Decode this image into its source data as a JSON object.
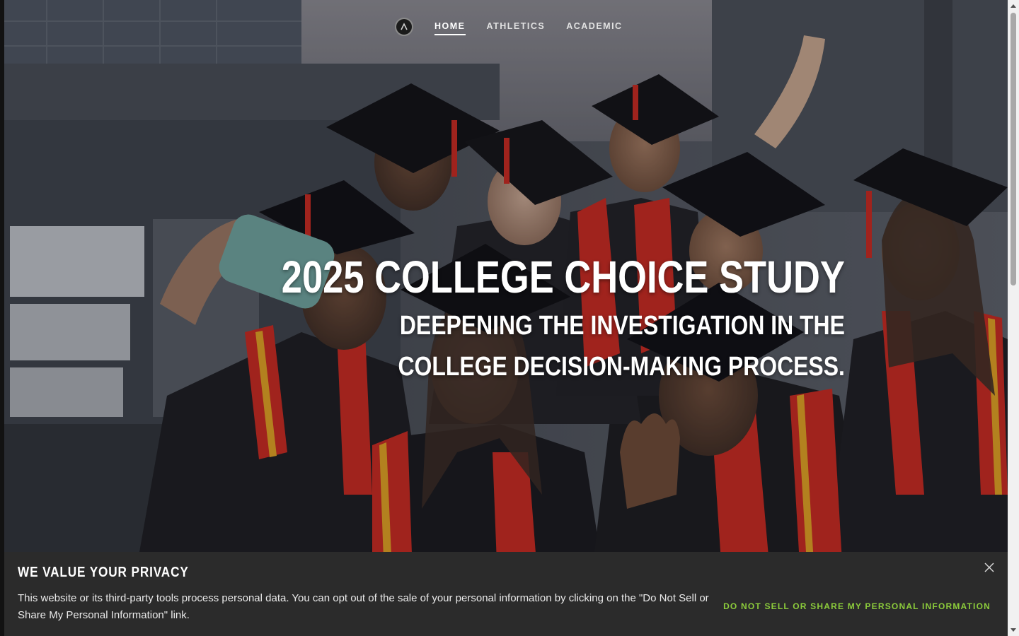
{
  "nav": {
    "logo_icon": "logo-circle-icon",
    "items": [
      {
        "label": "HOME",
        "active": true
      },
      {
        "label": "ATHLETICS",
        "active": false
      },
      {
        "label": "ACADEMIC",
        "active": false
      }
    ]
  },
  "hero": {
    "title": "2025 COLLEGE CHOICE STUDY",
    "subtitle_line1": "DEEPENING THE INVESTIGATION IN THE",
    "subtitle_line2": "COLLEGE DECISION-MAKING PROCESS."
  },
  "privacy": {
    "heading": "WE VALUE YOUR PRIVACY",
    "body": "This website or its third-party tools process personal data. You can opt out of the sale of your personal information by clicking on the \"Do Not Sell or Share My Personal Information\" link.",
    "optout_label": "DO NOT SELL OR SHARE MY PERSONAL INFORMATION",
    "close_icon": "close-icon"
  },
  "colors": {
    "accent_green": "#8ccc3b",
    "banner_bg": "#2b2b2b",
    "gown_red": "#c8281e",
    "stole_gold": "#e0a020"
  }
}
